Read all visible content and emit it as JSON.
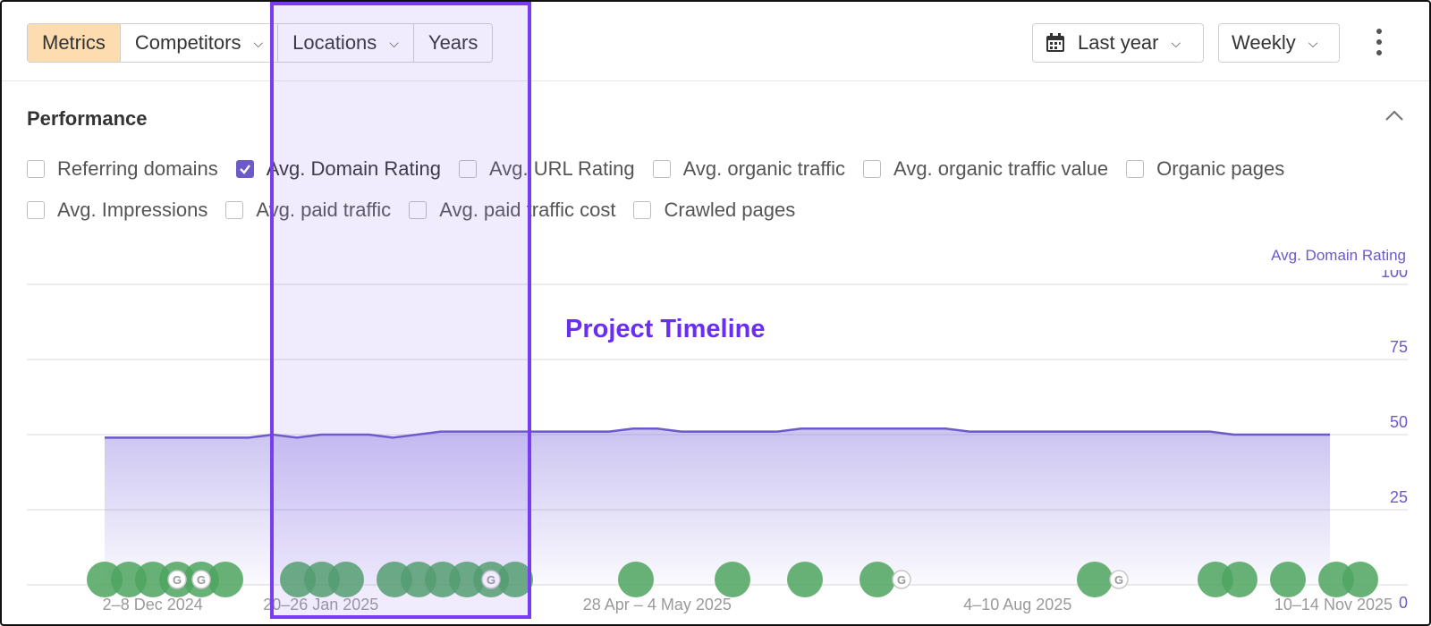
{
  "toolbar": {
    "segments": [
      {
        "label": "Metrics",
        "active": true,
        "has_chevron": false
      },
      {
        "label": "Competitors",
        "active": false,
        "has_chevron": true
      },
      {
        "label": "Locations",
        "active": false,
        "has_chevron": true
      },
      {
        "label": "Years",
        "active": false,
        "has_chevron": false
      }
    ],
    "date_range": "Last year",
    "granularity": "Weekly",
    "date_icon": "calendar-icon",
    "more_icon": "kebab-menu-icon"
  },
  "performance": {
    "title": "Performance",
    "collapse_icon": "chevron-up-icon",
    "metrics_row1": [
      {
        "label": "Referring domains",
        "checked": false
      },
      {
        "label": "Avg. Domain Rating",
        "checked": true
      },
      {
        "label": "Avg. URL Rating",
        "checked": false
      },
      {
        "label": "Avg. organic traffic",
        "checked": false
      },
      {
        "label": "Avg. organic traffic value",
        "checked": false
      },
      {
        "label": "Organic pages",
        "checked": false
      }
    ],
    "metrics_row2": [
      {
        "label": "Avg. Impressions",
        "checked": false
      },
      {
        "label": "Avg. paid traffic",
        "checked": false
      },
      {
        "label": "Avg. paid traffic cost",
        "checked": false
      },
      {
        "label": "Crawled pages",
        "checked": false
      }
    ]
  },
  "overlay": {
    "title": "Project Timeline"
  },
  "colors": {
    "accent": "#6b5ac8",
    "highlight_border": "#7a3cf2",
    "event_marker": "#4ea45f",
    "active_segment": "#fddcb0"
  },
  "chart_data": {
    "type": "area",
    "series": [
      {
        "name": "Avg. Domain Rating",
        "x_index": [
          0,
          1,
          2,
          3,
          4,
          5,
          6,
          7,
          8,
          9,
          10,
          11,
          12,
          13,
          14,
          15,
          16,
          17,
          18,
          19,
          20,
          21,
          22,
          23,
          24,
          25,
          26,
          27,
          28,
          29,
          30,
          31,
          32,
          33,
          34,
          35,
          36,
          37,
          38,
          39,
          40,
          41,
          42,
          43,
          44,
          45,
          46,
          47,
          48,
          49,
          50,
          51
        ],
        "values": [
          49,
          49,
          49,
          49,
          49,
          49,
          49,
          50,
          49,
          50,
          50,
          50,
          49,
          50,
          51,
          51,
          51,
          51,
          51,
          51,
          51,
          51,
          52,
          52,
          51,
          51,
          51,
          51,
          51,
          52,
          52,
          52,
          52,
          52,
          52,
          52,
          51,
          51,
          51,
          51,
          51,
          51,
          51,
          51,
          51,
          51,
          51,
          50,
          50,
          50,
          50,
          50
        ]
      }
    ],
    "x_tick_labels": [
      "2–8 Dec 2024",
      "20–26 Jan 2025",
      "28 Apr – 4 May 2025",
      "4–10 Aug 2025",
      "10–14 Nov 2025"
    ],
    "x_tick_index": [
      2,
      9,
      23,
      38,
      51
    ],
    "y_ticks": [
      "100",
      "75",
      "50",
      "25",
      "0"
    ],
    "y_tick_values": [
      100,
      75,
      50,
      25,
      0
    ],
    "ylim": [
      0,
      100
    ],
    "ylabel": "Avg. Domain Rating",
    "grid": true,
    "event_markers_index": [
      0,
      1,
      2,
      3,
      4,
      5,
      8,
      9,
      10,
      12,
      13,
      14,
      15,
      16,
      17,
      22,
      26,
      29,
      32,
      41,
      46,
      47,
      49,
      51,
      52
    ],
    "google_markers_index": [
      3,
      4,
      16,
      33,
      42
    ]
  }
}
